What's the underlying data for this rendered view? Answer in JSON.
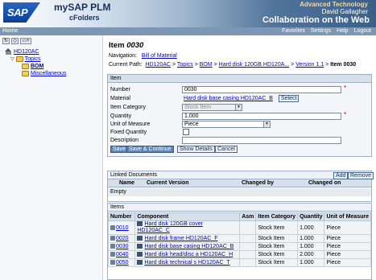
{
  "header": {
    "logo_text": "SAP",
    "product": "mySAP PLM",
    "subproduct": "cFolders",
    "company": "Advanced Technology",
    "user": "David Gallagher",
    "tagline": "Collaboration on the Web"
  },
  "navbar": {
    "home": "Home",
    "links": [
      "Favorites",
      "Settings",
      "Help",
      "Logout"
    ]
  },
  "tree": {
    "root": "HD120AC",
    "topics": "Topics",
    "bom": "BOM",
    "misc": "Miscellaneous"
  },
  "page": {
    "title_prefix": "Item ",
    "title_number": "0030",
    "navigation_label": "Navigation:",
    "navigation_link": "Bill of Material",
    "path_label": "Current Path:",
    "path": [
      "HD120AC",
      "Topics",
      "BOM",
      "Hard disk 120GB HD120A...",
      "Version 1.1"
    ],
    "path_sep": " > ",
    "path_current": "Item 0030"
  },
  "form": {
    "section": "Item",
    "number_label": "Number",
    "number_value": "0030",
    "material_label": "Material",
    "material_value": "Hard disk base casing HD120AC_B",
    "select_label": "Select",
    "category_label": "Item Category",
    "category_value": "Stock Item",
    "quantity_label": "Quantity",
    "quantity_value": "1.000",
    "uom_label": "Unit of Measure",
    "uom_value": "Piece",
    "fixed_label": "Fixed Quantity",
    "description_label": "Description",
    "description_value": "",
    "buttons": [
      "Save",
      "Save & Continue",
      "Show Details",
      "Cancel"
    ]
  },
  "docs": {
    "section": "Linked Documents",
    "add": "Add",
    "remove": "Remove",
    "cols": [
      "Name",
      "Current Version",
      "Changed by",
      "Changed on"
    ],
    "empty": "Empty"
  },
  "items": {
    "section": "Items",
    "cols": [
      "Number",
      "Component",
      "Asm",
      "Item Category",
      "Quantity",
      "Unit of Measure"
    ],
    "rows": [
      {
        "number": "0010",
        "component": "Hard disk 120GB cover",
        "component2": "HD120AC_C",
        "asm": "",
        "category": "Stock Item",
        "quantity": "1.000",
        "uom": "Piece"
      },
      {
        "number": "0020",
        "component": "Hard disk frame HD120AC_F",
        "component2": "",
        "asm": "",
        "category": "Stock Item",
        "quantity": "1.000",
        "uom": "Piece"
      },
      {
        "number": "0030",
        "component": "Hard disk base casing HD120AC_B",
        "component2": "",
        "asm": "",
        "category": "Stock Item",
        "quantity": "1.000",
        "uom": "Piece"
      },
      {
        "number": "0040",
        "component": "Hard disk head/disc a HD120AC_H",
        "component2": "",
        "asm": "",
        "category": "Stock Item",
        "quantity": "2.000",
        "uom": "Piece"
      },
      {
        "number": "0050",
        "component": "Hard disk technical s HD120AC_T",
        "component2": "",
        "asm": "",
        "category": "Stock Item",
        "quantity": "1.000",
        "uom": "Piece"
      }
    ]
  }
}
